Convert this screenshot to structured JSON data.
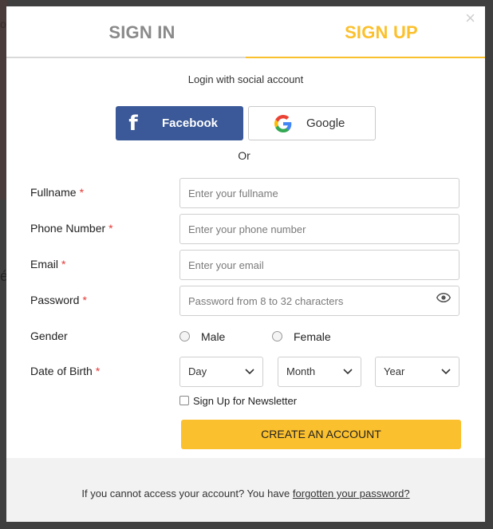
{
  "backdrop": {
    "text_top": "ou",
    "text_mid": "é"
  },
  "tabs": {
    "sign_in": "SIGN IN",
    "sign_up": "SIGN UP",
    "active_color": "#fbc02d"
  },
  "close_glyph": "×",
  "social": {
    "title": "Login with social account",
    "facebook_label": "Facebook",
    "google_label": "Google",
    "or": "Or",
    "facebook_color": "#3b5998"
  },
  "form": {
    "fullname": {
      "label": "Fullname",
      "required": "*",
      "placeholder": "Enter your fullname"
    },
    "phone": {
      "label": "Phone Number",
      "required": "*",
      "placeholder": "Enter your phone number"
    },
    "email": {
      "label": "Email",
      "required": "*",
      "placeholder": "Enter your email"
    },
    "password": {
      "label": "Password",
      "required": "*",
      "placeholder": "Password from 8 to 32 characters"
    },
    "gender": {
      "label": "Gender",
      "options": [
        "Male",
        "Female"
      ]
    },
    "dob": {
      "label": "Date of Birth",
      "required": "*",
      "day": "Day",
      "month": "Month",
      "year": "Year"
    },
    "newsletter_label": "Sign Up for Newsletter",
    "submit_label": "CREATE AN ACCOUNT"
  },
  "footer": {
    "text": "If you cannot access your account? You have ",
    "link": "forgotten your password?"
  },
  "icons": {
    "facebook": "facebook-icon",
    "google": "google-icon",
    "eye": "eye-icon",
    "chevron": "chevron-down-icon",
    "close": "close-icon"
  }
}
